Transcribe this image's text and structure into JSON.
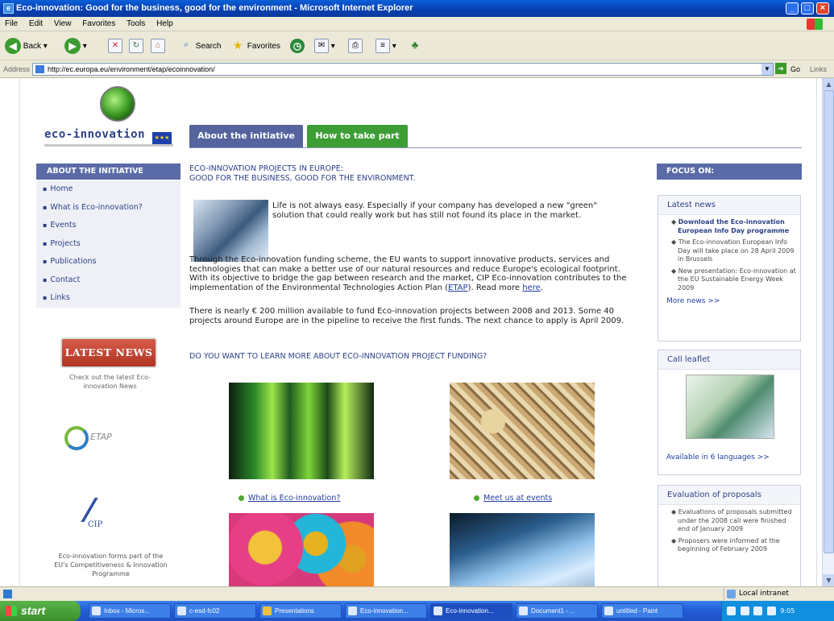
{
  "window": {
    "title": "Eco-innovation: Good for the business, good for the environment - Microsoft Internet Explorer"
  },
  "menu": [
    "File",
    "Edit",
    "View",
    "Favorites",
    "Tools",
    "Help"
  ],
  "toolbar": {
    "back": "Back",
    "search": "Search",
    "favorites": "Favorites"
  },
  "address": {
    "label": "Address",
    "url": "http://ec.europa.eu/environment/etap/ecoinnovation/",
    "go": "Go",
    "links": "Links"
  },
  "logo": {
    "text": "eco-innovation"
  },
  "tabs": {
    "about": "About the initiative",
    "take_part": "How to take part"
  },
  "sidebar": {
    "header": "ABOUT THE INITIATIVE",
    "items": [
      "Home",
      "What is Eco-innovation?",
      "Events",
      "Projects",
      "Publications",
      "Contact",
      "Links"
    ],
    "latest_news": "LATEST NEWS",
    "latest_news_caption": "Check out the latest Eco-innovation News",
    "etap": "ETAP",
    "cip": "CIP",
    "cip_caption": "Eco-innovation forms part of the EU's Competitiveness & Innovation Programme"
  },
  "main": {
    "heading": "ECO-INNOVATION PROJECTS IN EUROPE:",
    "subheading": "GOOD FOR THE BUSINESS, GOOD FOR THE ENVIRONMENT.",
    "para1": "Life is not always easy. Especially if your company has developed a new \"green\" solution that could really work but has still not found its place in the market.",
    "para2_a": "Through the Eco-innovation funding scheme, the EU wants to support innovative products, services and technologies that can make a better use of our natural resources and reduce Europe's ecological footprint. With its objective to bridge the gap between research and the market, CIP Eco-innovation contributes to the implementation of the Environmental Technologies Action Plan (",
    "para2_link1": "ETAP",
    "para2_b": "). Read more ",
    "para2_link2": "here",
    "para2_c": ".",
    "para3": "There is nearly € 200 million available to fund Eco-innovation projects between 2008 and 2013. Some 40 projects around Europe are in the pipeline to receive the first funds. The next chance to apply is April 2009.",
    "question": "DO YOU WANT TO LEARN MORE ABOUT ECO-INNOVATION PROJECT FUNDING?",
    "caption_what": "What is Eco-innovation?",
    "caption_events": "Meet us at events"
  },
  "right": {
    "focus_header": "FOCUS ON:",
    "latest_news_title": "Latest news",
    "news": [
      {
        "text": "Download the Eco-innovation European Info Day programme",
        "bold": true
      },
      {
        "text": "The Eco-innovation European Info Day will take place on 28 April 2009 in Brussels",
        "bold": false
      },
      {
        "text": "New presentation: Eco-innovation at the EU Sustainable Energy Week 2009",
        "bold": false
      }
    ],
    "more_news": "More news >>",
    "leaflet_title": "Call leaflet",
    "leaflet_link": "Available in 6 languages >>",
    "evaluation_title": "Evaluation of proposals",
    "evaluation": [
      "Evaluations of proposals submitted under the 2008 call were finished end of January 2009",
      "Proposers were informed at the beginning of February 2009"
    ]
  },
  "status": {
    "zone": "Local intranet"
  },
  "taskbar": {
    "start": "start",
    "tasks": [
      "Inbox - Micros...",
      "c-esd-fc02",
      "Presentations",
      "Eco-innovation...",
      "Eco-innovation...",
      "Document1 - ...",
      "untitled - Paint"
    ],
    "clock": "9:05"
  },
  "colors": {
    "nav_blue": "#5b6ba8",
    "green_tab": "#3d9e35",
    "link": "#1f3da0"
  }
}
